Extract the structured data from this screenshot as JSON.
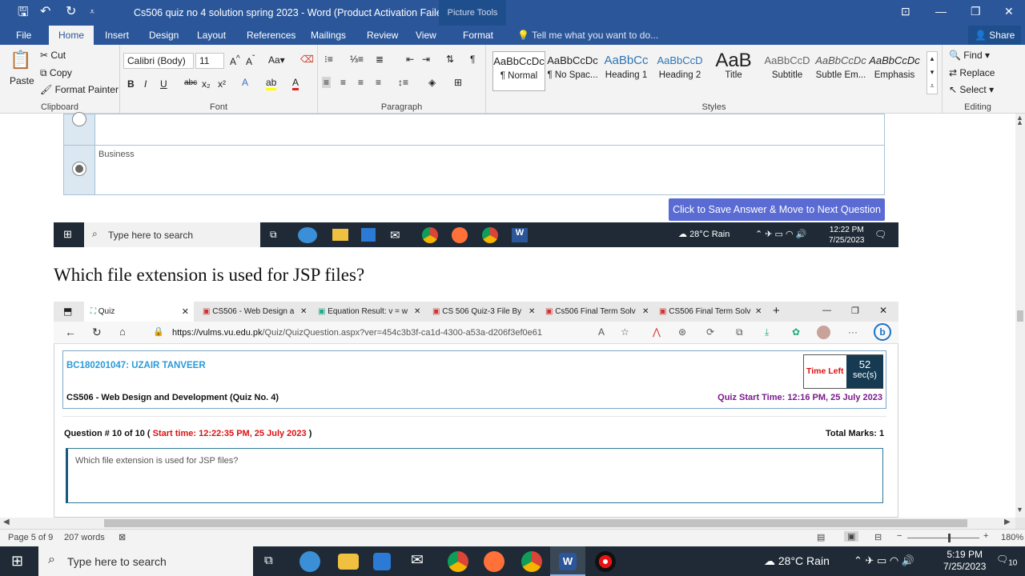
{
  "word": {
    "title": "Cs506 quiz no 4 solution spring 2023 - Word (Product Activation Failed)",
    "picture_tools": "Picture Tools",
    "tabs": [
      "File",
      "Home",
      "Insert",
      "Design",
      "Layout",
      "References",
      "Mailings",
      "Review",
      "View",
      "Format"
    ],
    "tell_me": "Tell me what you want to do...",
    "share": "Share",
    "clipboard": {
      "paste": "Paste",
      "cut": "Cut",
      "copy": "Copy",
      "format_painter": "Format Painter",
      "label": "Clipboard"
    },
    "font": {
      "name": "Calibri (Body)",
      "size": "11",
      "label": "Font"
    },
    "paragraph_label": "Paragraph",
    "styles": [
      {
        "preview": "AaBbCcDc",
        "name": "¶ Normal"
      },
      {
        "preview": "AaBbCcDc",
        "name": "¶ No Spac..."
      },
      {
        "preview": "AaBbCc",
        "name": "Heading 1"
      },
      {
        "preview": "AaBbCcD",
        "name": "Heading 2"
      },
      {
        "preview": "AaB",
        "name": "Title"
      },
      {
        "preview": "AaBbCcD",
        "name": "Subtitle"
      },
      {
        "preview": "AaBbCcDc",
        "name": "Subtle Em..."
      },
      {
        "preview": "AaBbCcDc",
        "name": "Emphasis"
      }
    ],
    "styles_label": "Styles",
    "editing": {
      "find": "Find",
      "replace": "Replace",
      "select": "Select",
      "label": "Editing"
    },
    "status": {
      "page": "Page 5 of 9",
      "words": "207 words",
      "zoom": "180%"
    }
  },
  "document": {
    "option_business": "Business",
    "save_button": "Click to Save Answer & Move to Next Question",
    "question_heading": "Which file extension is used for JSP files?"
  },
  "inner_taskbar": {
    "search": "Type here to search",
    "weather": "28°C  Rain",
    "time": "12:22 PM",
    "date": "7/25/2023"
  },
  "browser": {
    "tabs": [
      "Quiz",
      "CS506 - Web Design a",
      "Equation Result: v = w",
      "CS 506 Quiz-3 File By",
      "Cs506 Final Term Solv",
      "CS506 Final Term Solv"
    ],
    "url_host": "https://vulms.vu.edu.pk",
    "url_path": "/Quiz/QuizQuestion.aspx?ver=454c3b3f-ca1d-4300-a53a-d206f3ef0e61",
    "student": "BC180201047: UZAIR TANVEER",
    "course": "CS506 - Web Design and Development (Quiz No. 4)",
    "time_left_label": "Time Left",
    "time_left_value": "52",
    "time_left_unit": "sec(s)",
    "quiz_start": "Quiz Start Time: 12:16 PM, 25 July 2023",
    "question_num": "Question # 10 of 10 (",
    "start_time": "Start time: 12:22:35 PM, 25 July 2023",
    "close_paren": ")",
    "total_marks": "Total Marks: 1",
    "question_text": "Which file extension is used for JSP files?"
  },
  "taskbar": {
    "search": "Type here to search",
    "weather": "28°C  Rain",
    "time": "5:19 PM",
    "date": "7/25/2023",
    "notif": "10"
  }
}
